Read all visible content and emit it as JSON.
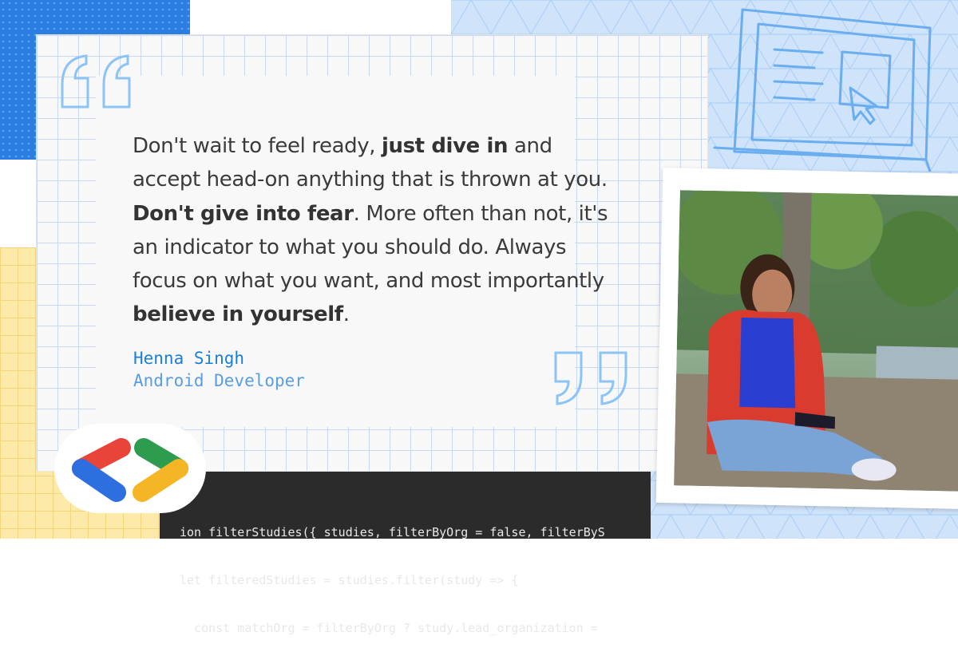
{
  "quote": {
    "segments": [
      {
        "text": "Don't wait to feel ready, ",
        "bold": false
      },
      {
        "text": "just dive in",
        "bold": true
      },
      {
        "text": " and accept head-on anything that is thrown at you. ",
        "bold": false
      },
      {
        "text": "Don't give into fear",
        "bold": true
      },
      {
        "text": ". More often than not, it's an indicator to what you should do. Always focus on what you want, and most importantly ",
        "bold": false
      },
      {
        "text": "believe in yourself",
        "bold": true
      },
      {
        "text": ".",
        "bold": false
      }
    ]
  },
  "author": {
    "name": "Henna Singh",
    "role": "Android Developer"
  },
  "code": {
    "lines": [
      "ion filterStudies({ studies, filterByOrg = false, filterByS",
      "let filteredStudies = studies.filter(study => {",
      "  const matchOrg = filterByOrg ? study.lead_organization ="
    ]
  },
  "colors": {
    "accent_blue": "#1a7fd9",
    "quote_mark_blue": "#8cc4f5",
    "background_blue": "#2a7de1",
    "background_yellow": "#fde9a8"
  },
  "icons": {
    "open_quote": "open-quote-icon",
    "close_quote": "close-quote-icon",
    "laptop": "laptop-icon",
    "brand": "developer-brackets-logo"
  }
}
